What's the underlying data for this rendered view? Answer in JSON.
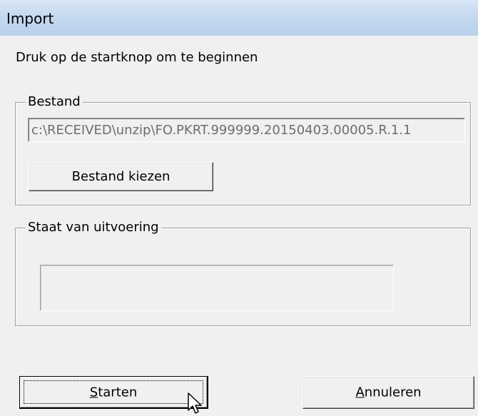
{
  "window": {
    "title": "Import"
  },
  "instruction": "Druk op de startknop om te beginnen",
  "bestand_group": {
    "legend": "Bestand",
    "path_value": "c:\\RECEIVED\\unzip\\FO.PKRT.999999.20150403.00005.R.1.1",
    "choose_button": "Bestand kiezen"
  },
  "staat_group": {
    "legend": "Staat van uitvoering",
    "progress": 0
  },
  "footer": {
    "start_button": {
      "mnemonic": "S",
      "rest": "tarten"
    },
    "cancel_button": {
      "mnemonic": "A",
      "rest": "nnuleren"
    }
  },
  "cursor_icon": "arrow-pointer-icon"
}
